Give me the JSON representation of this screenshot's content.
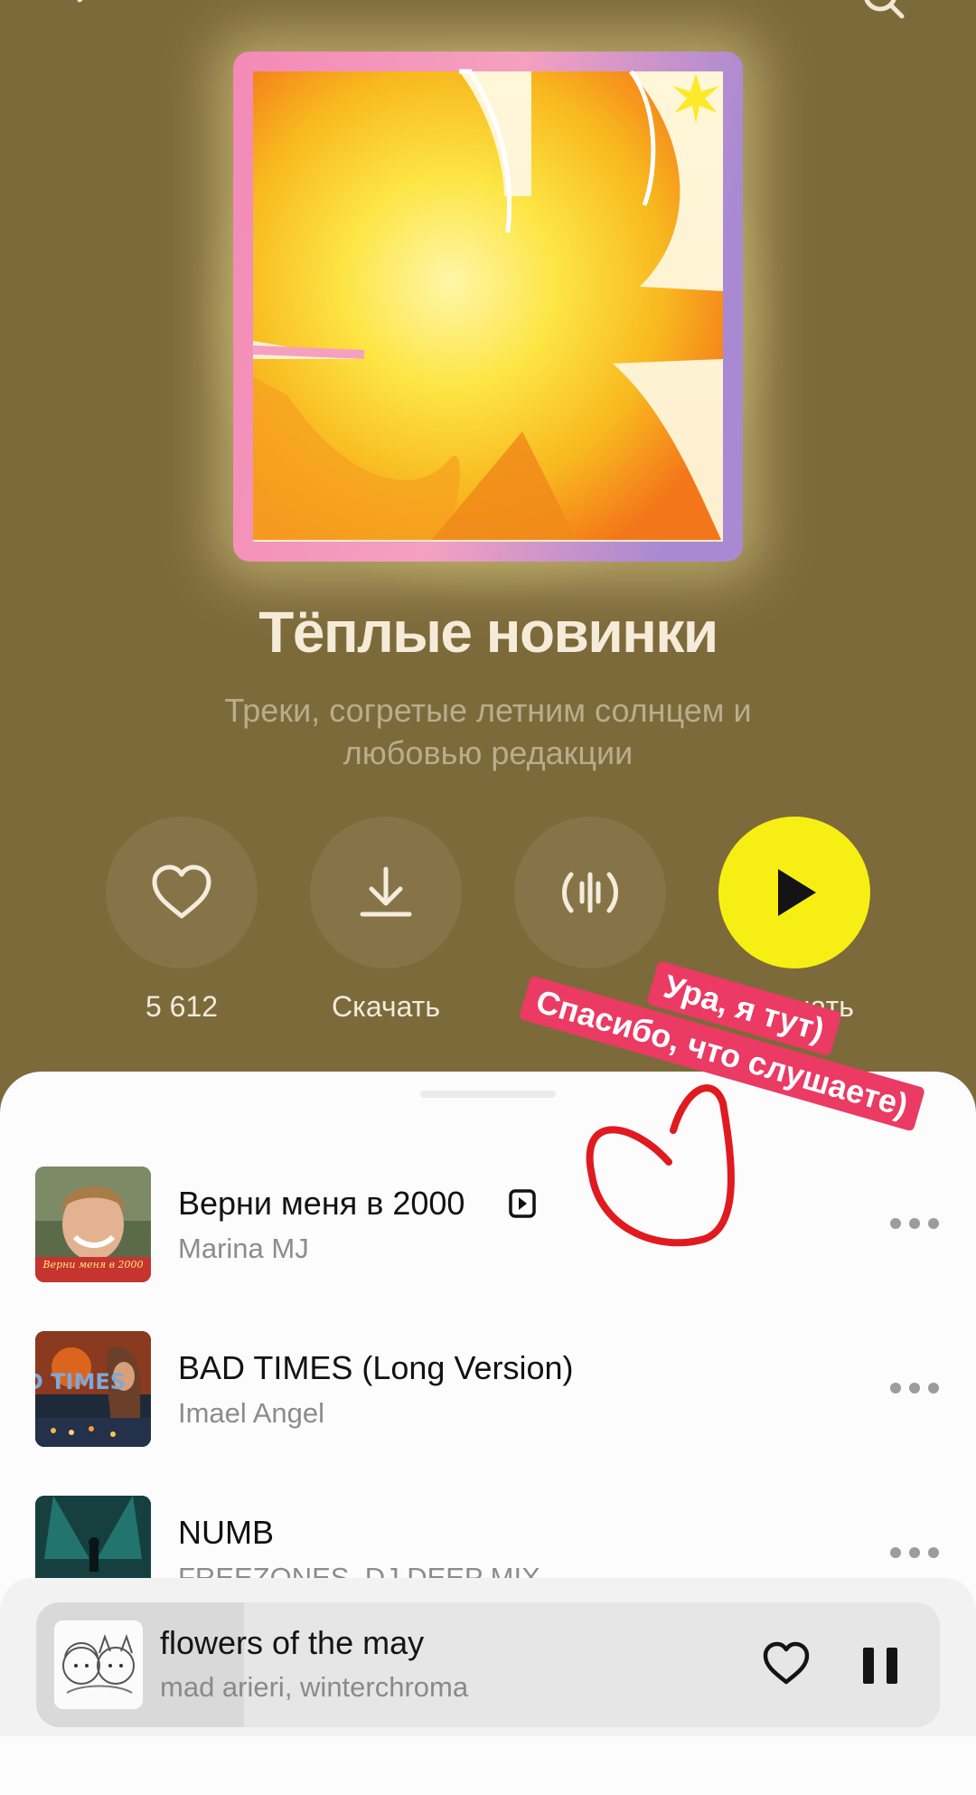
{
  "header": {
    "back_icon": "chevron-left-icon",
    "search_icon": "search-icon"
  },
  "playlist": {
    "title": "Тёплые новинки",
    "subtitle": "Треки, согретые летним солнцем и любовью редакции",
    "actions": {
      "likes_count": "5 612",
      "download_label": "Скачать",
      "play_label": "Слушать"
    },
    "colors": {
      "background": "#7d6a3b",
      "play_button": "#f7ef13"
    }
  },
  "tracks": [
    {
      "title": "Верни меня в 2000",
      "artist": "Marina MJ",
      "cover_caption": "Верни меня в 2000",
      "has_video": true
    },
    {
      "title": "BAD TIMES (Long Version)",
      "artist": "Imael Angel",
      "cover_caption": "BAD TIMES"
    },
    {
      "title": "NUMB",
      "artist": "FREEZONES, DJ DEEP MIX"
    }
  ],
  "now_playing": {
    "title": "flowers of the may",
    "artist": "mad arieri, winterchroma",
    "progress": 0.23
  },
  "sticker": {
    "line1": "Ура, я тут)",
    "line2": "Спасибо, что слушаете)",
    "color": "#eb3a63"
  }
}
